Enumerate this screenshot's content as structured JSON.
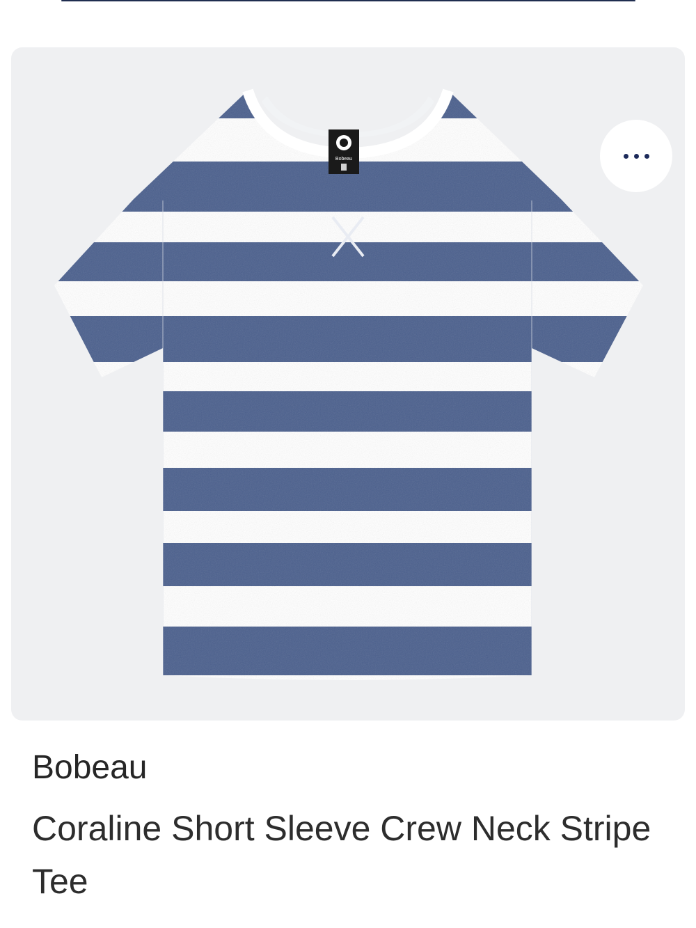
{
  "product": {
    "brand": "Bobeau",
    "title": "Coraline Short Sleeve Crew Neck Stripe Tee",
    "image_label_brand": "Bobeau",
    "image_alt": "Coraline Short Sleeve Crew Neck Stripe Tee"
  },
  "actions": {
    "more_icon": "ellipsis-icon",
    "more_label": "More options"
  },
  "colors": {
    "card_background": "#eff0f2",
    "stripe_navy": "#4a5f8d",
    "stripe_white": "#ffffff",
    "accent_navy": "#1c2a5a",
    "text_primary": "#262626"
  }
}
